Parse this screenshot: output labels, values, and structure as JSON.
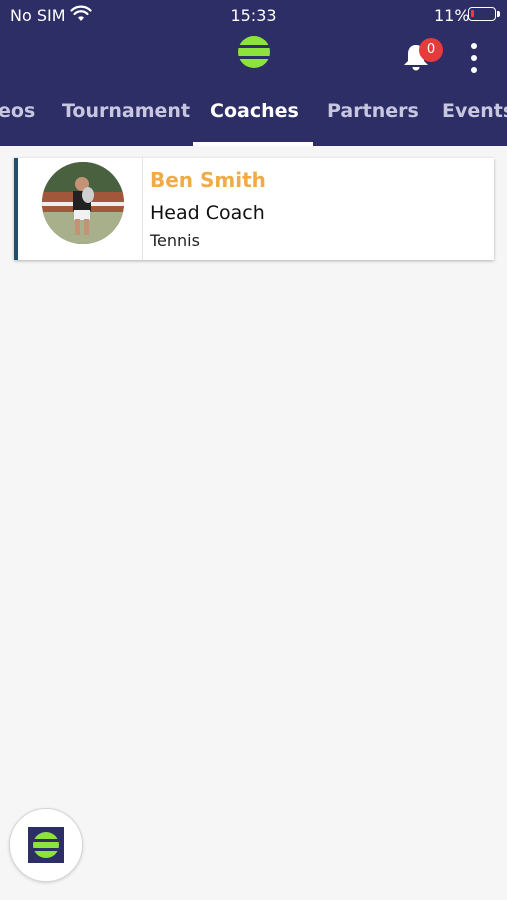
{
  "status_bar": {
    "carrier": "No SIM",
    "time": "15:33",
    "battery": "11%"
  },
  "header": {
    "notification_count": "0"
  },
  "tabs": [
    {
      "label": "eos"
    },
    {
      "label": "Tournament"
    },
    {
      "label": "Coaches"
    },
    {
      "label": "Partners"
    },
    {
      "label": "Events"
    }
  ],
  "active_tab": "Coaches",
  "coaches": [
    {
      "name": "Ben Smith",
      "role": "Head Coach",
      "sport": "Tennis"
    }
  ],
  "colors": {
    "header_bg": "#2d2e66",
    "accent_name": "#f0ab48",
    "logo_green": "#8be33c",
    "badge_red": "#e63b3b"
  }
}
